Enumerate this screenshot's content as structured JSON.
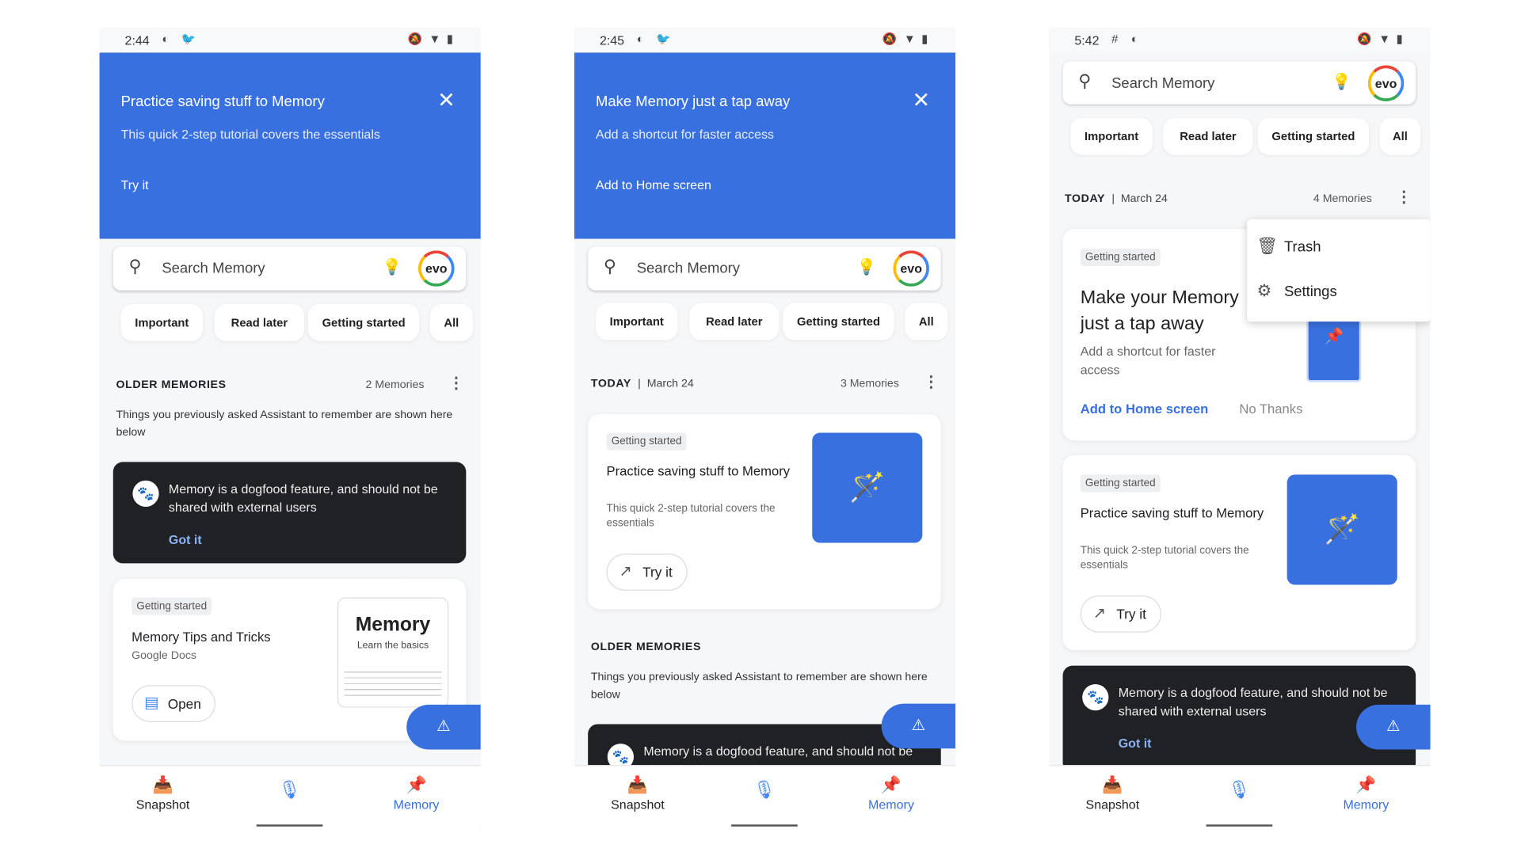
{
  "status_icons": {
    "dnd": "bell-off-icon",
    "wifi": "wifi-icon",
    "battery": "battery-icon"
  },
  "colors": {
    "accent": "#3870e0",
    "dark_card": "#202124",
    "link": "#8ab4f8"
  },
  "common": {
    "search_placeholder": "Search Memory",
    "avatar": "evo",
    "chips": [
      "Important",
      "Read later",
      "Getting started",
      "All"
    ],
    "older_title": "OLDER MEMORIES",
    "older_desc": "Things you previously asked Assistant to remember are shown here below",
    "today": "TODAY",
    "date": "March 24",
    "tag": "Getting started",
    "practice_title": "Practice saving stuff to Memory",
    "practice_sub": "This quick 2-step tutorial covers the essentials",
    "try_it": "Try it",
    "dogfood": "Memory is a dogfood feature, and should not be shared with external users",
    "got_it": "Got it",
    "nav": {
      "snapshot": "Snapshot",
      "memory": "Memory"
    }
  },
  "phone1": {
    "time": "2:44",
    "banner": {
      "title": "Practice saving stuff to Memory",
      "subtitle": "This quick 2-step tutorial covers the essentials",
      "action": "Try it"
    },
    "count": "2 Memories",
    "doc_card": {
      "title": "Memory Tips and Tricks",
      "source": "Google Docs",
      "open": "Open",
      "thumb_title": "Memory",
      "thumb_sub": "Learn the basics"
    }
  },
  "phone2": {
    "time": "2:45",
    "banner": {
      "title": "Make Memory just a tap away",
      "subtitle": "Add a shortcut for faster access",
      "action": "Add to Home screen"
    },
    "count": "3 Memories"
  },
  "phone3": {
    "time": "5:42",
    "count": "4 Memories",
    "shortcut_card": {
      "title": "Make your Memory just a tap away",
      "sub": "Add a shortcut for faster access",
      "primary": "Add to Home screen",
      "secondary": "No Thanks"
    },
    "menu": [
      "Trash",
      "Settings"
    ]
  }
}
